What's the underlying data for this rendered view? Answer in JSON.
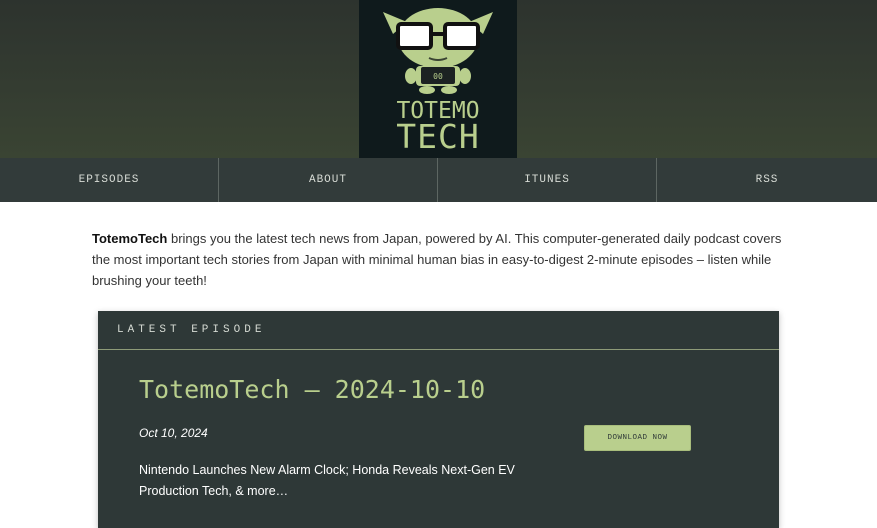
{
  "brand": {
    "logo_line1": "TOTEMO",
    "logo_line2": "TECH",
    "logo_icon": "goblin-mascot-icon",
    "accent_color": "#b9cf8d"
  },
  "nav": {
    "items": [
      {
        "label": "EPISODES"
      },
      {
        "label": "ABOUT"
      },
      {
        "label": "ITUNES"
      },
      {
        "label": "RSS"
      }
    ]
  },
  "intro": {
    "brand_name": "TotemoTech",
    "text": " brings you the latest tech news from Japan, powered by AI. This computer-generated daily podcast covers the most important tech stories from Japan with minimal human bias in easy-to-digest 2-minute episodes – listen while brushing your teeth!"
  },
  "latest": {
    "header": "LATEST EPISODE",
    "title": "TotemoTech – 2024-10-10",
    "date": "Oct 10, 2024",
    "description": "Nintendo Launches New Alarm Clock; Honda Reveals Next-Gen EV Production Tech, & more…",
    "download_label": "DOWNLOAD NOW"
  }
}
